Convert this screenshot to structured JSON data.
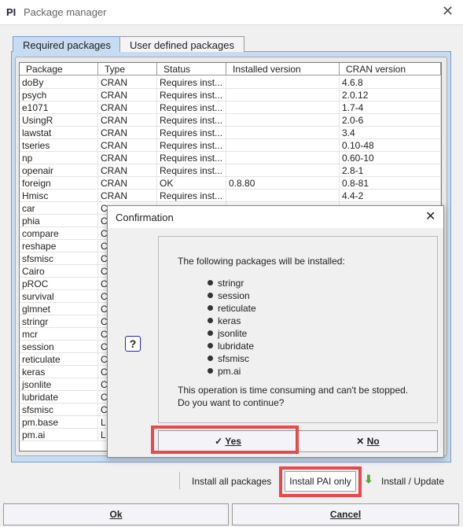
{
  "window": {
    "title": "Package manager",
    "logo": "PI"
  },
  "tabs": [
    {
      "label": "Required packages"
    },
    {
      "label": "User defined packages"
    }
  ],
  "table": {
    "columns": [
      "Package",
      "Type",
      "Status",
      "Installed version",
      "CRAN version"
    ],
    "rows": [
      [
        "doBy",
        "CRAN",
        "Requires inst...",
        "",
        "4.6.8"
      ],
      [
        "psych",
        "CRAN",
        "Requires inst...",
        "",
        "2.0.12"
      ],
      [
        "e1071",
        "CRAN",
        "Requires inst...",
        "",
        "1.7-4"
      ],
      [
        "UsingR",
        "CRAN",
        "Requires inst...",
        "",
        "2.0-6"
      ],
      [
        "lawstat",
        "CRAN",
        "Requires inst...",
        "",
        "3.4"
      ],
      [
        "tseries",
        "CRAN",
        "Requires inst...",
        "",
        "0.10-48"
      ],
      [
        "np",
        "CRAN",
        "Requires inst...",
        "",
        "0.60-10"
      ],
      [
        "openair",
        "CRAN",
        "Requires inst...",
        "",
        "2.8-1"
      ],
      [
        "foreign",
        "CRAN",
        "OK",
        "0.8.80",
        "0.8-81"
      ],
      [
        "Hmisc",
        "CRAN",
        "Requires inst...",
        "",
        "4.4-2"
      ],
      [
        "car",
        "C",
        "",
        "",
        ""
      ],
      [
        "phia",
        "C",
        "",
        "",
        ""
      ],
      [
        "compare",
        "C",
        "",
        "",
        ""
      ],
      [
        "reshape",
        "C",
        "",
        "",
        ""
      ],
      [
        "sfsmisc",
        "C",
        "",
        "",
        ""
      ],
      [
        "Cairo",
        "C",
        "",
        "",
        ""
      ],
      [
        "pROC",
        "C",
        "",
        "",
        ""
      ],
      [
        "survival",
        "C",
        "",
        "",
        ""
      ],
      [
        "glmnet",
        "C",
        "",
        "",
        ""
      ],
      [
        "stringr",
        "C",
        "",
        "",
        ""
      ],
      [
        "mcr",
        "C",
        "",
        "",
        ""
      ],
      [
        "session",
        "C",
        "",
        "",
        ""
      ],
      [
        "reticulate",
        "C",
        "",
        "",
        ""
      ],
      [
        "keras",
        "C",
        "",
        "",
        ""
      ],
      [
        "jsonlite",
        "C",
        "",
        "",
        ""
      ],
      [
        "lubridate",
        "C",
        "",
        "",
        ""
      ],
      [
        "sfsmisc",
        "C",
        "",
        "",
        ""
      ],
      [
        "pm.base",
        "L",
        "",
        "",
        ""
      ],
      [
        "pm.ai",
        "L",
        "",
        "",
        ""
      ]
    ]
  },
  "dialog": {
    "title": "Confirmation",
    "intro": "The following packages will be installed:",
    "packages": [
      "stringr",
      "session",
      "reticulate",
      "keras",
      "jsonlite",
      "lubridate",
      "sfsmisc",
      "pm.ai"
    ],
    "warning1": "This operation is time consuming and can't be stopped.",
    "warning2": "Do you want to continue?",
    "icon": "question-icon",
    "icon_glyph": "?",
    "yes": "Yes",
    "no": "No"
  },
  "actions": {
    "install_all": "Install all packages",
    "install_pai": "Install PAI only",
    "install_update": "Install / Update"
  },
  "footer": {
    "ok": "Ok",
    "cancel": "Cancel"
  },
  "colors": {
    "highlight": "#e9484c",
    "tab_active": "#c7dcf2"
  }
}
